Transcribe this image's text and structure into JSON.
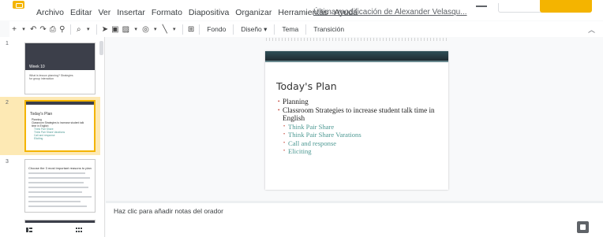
{
  "menu": [
    "Archivo",
    "Editar",
    "Ver",
    "Insertar",
    "Formato",
    "Diapositiva",
    "Organizar",
    "Herramientas",
    "Ayuda"
  ],
  "last_modified": "Última modificación de Alexander Velasqu...",
  "toolbar": {
    "fondo": "Fondo",
    "diseno": "Diseño ▾",
    "tema": "Tema",
    "transicion": "Transición"
  },
  "filmstrip": {
    "slide_numbers": [
      "1",
      "2",
      "3"
    ],
    "thumb1_title": "Week 10",
    "thumb1_sub": "What is lesson planning? Strategies for group interaction",
    "thumb3_title": "Choose the 3 most important reasons to plan"
  },
  "slide": {
    "title": "Today's Plan",
    "bullets": [
      {
        "text": "Planning",
        "level": 1
      },
      {
        "text": "Classroom Strategies to increase student talk time in English",
        "level": 1
      },
      {
        "text": "Think Pair Share",
        "level": 2
      },
      {
        "text": "Think Pair Share Varations",
        "level": 2
      },
      {
        "text": "Call and response",
        "level": 2
      },
      {
        "text": "Eliciting",
        "level": 2
      }
    ]
  },
  "notes_placeholder": "Haz clic para añadir notas del orador",
  "colors": {
    "selected_slide": "#fde9b4",
    "accent": "#f4b400",
    "bullet_lvl2": "#4f9a94"
  }
}
